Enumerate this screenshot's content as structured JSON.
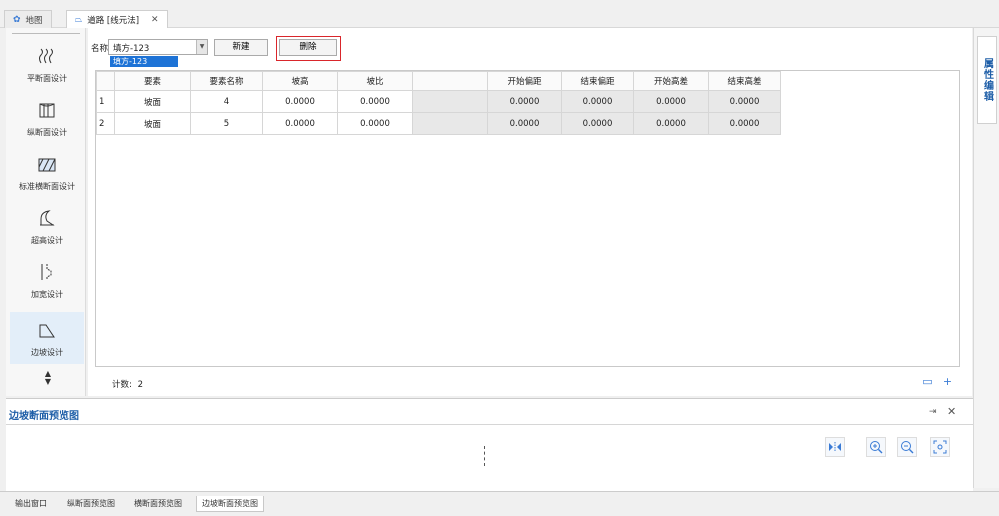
{
  "tabs": [
    {
      "label": "地图",
      "icon": "gear-icon"
    },
    {
      "label": "道路 [线元法]",
      "icon": "road-icon"
    }
  ],
  "right_panel": {
    "label": "属性编辑"
  },
  "sidebar": {
    "items": [
      {
        "label": "平断面设计",
        "icon": "plan-icon"
      },
      {
        "label": "纵断面设计",
        "icon": "profile-icon"
      },
      {
        "label": "标准横断面设计",
        "icon": "cross-section-icon"
      },
      {
        "label": "超高设计",
        "icon": "superelevation-icon"
      },
      {
        "label": "加宽设计",
        "icon": "widening-icon"
      },
      {
        "label": "边坡设计",
        "icon": "slope-icon",
        "active": true
      }
    ]
  },
  "form": {
    "name_label": "名称",
    "name_value": "填方-123",
    "dropdown_option": "填方-123",
    "new_button": "新建",
    "delete_button": "删除"
  },
  "table": {
    "headers": [
      "",
      "要素",
      "要素名称",
      "坡高",
      "坡比",
      "",
      "开始偏距",
      "结束偏距",
      "开始高差",
      "结束高差"
    ],
    "rows": [
      [
        "1",
        "坡面",
        "4",
        "0.0000",
        "0.0000",
        "",
        "0.0000",
        "0.0000",
        "0.0000",
        "0.0000"
      ],
      [
        "2",
        "坡面",
        "5",
        "0.0000",
        "0.0000",
        "",
        "0.0000",
        "0.0000",
        "0.0000",
        "0.0000"
      ]
    ]
  },
  "footer": {
    "count_label": "计数:",
    "count_value": "2"
  },
  "preview": {
    "title": "边坡断面预览图"
  },
  "bottom_tabs": [
    {
      "label": "输出窗口"
    },
    {
      "label": "纵断面预览图"
    },
    {
      "label": "横断面预览图"
    },
    {
      "label": "边坡断面预览图",
      "active": true
    }
  ],
  "colors": {
    "accent": "#1e73d6",
    "highlight": "#d9262b",
    "title_blue": "#1f5fa8"
  }
}
